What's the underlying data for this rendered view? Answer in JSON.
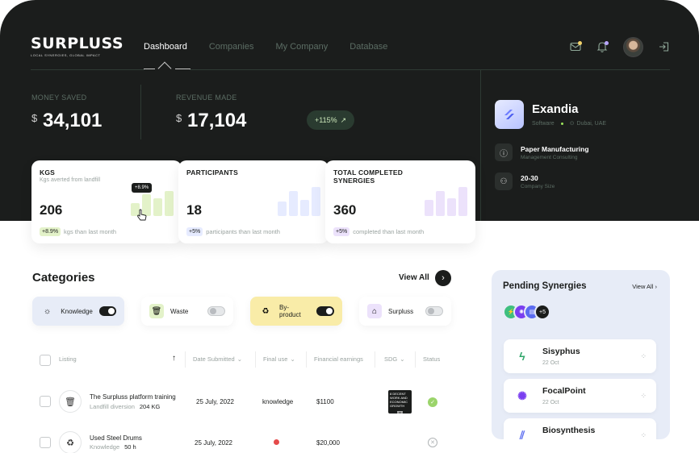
{
  "brand": {
    "logo_text": "SURPLUSS",
    "tagline": "LOCAL SYNERGIES, GLOBAL IMPACT"
  },
  "nav": {
    "tabs": [
      {
        "label": "Dashboard"
      },
      {
        "label": "Companies"
      },
      {
        "label": "My Company"
      },
      {
        "label": "Database"
      }
    ]
  },
  "header_icons": [
    "mail-icon",
    "bell-icon",
    "avatar",
    "logout-icon"
  ],
  "stats": {
    "money_saved": {
      "label": "MONEY SAVED",
      "currency": "$",
      "value": "34,101"
    },
    "revenue_made": {
      "label": "REVENUE MADE",
      "currency": "$",
      "value": "17,104",
      "growth": "+115%"
    }
  },
  "cards": [
    {
      "title": "KGS",
      "subtitle": "Kgs averted from landfill",
      "value": "206",
      "badge": "+8.9%",
      "footer": "kgs  than last month",
      "tooltip": "+8.9%",
      "accent": "#e3f2c9",
      "bar_levels": [
        0.45,
        0.75,
        0.6,
        0.85
      ]
    },
    {
      "title": "PARTICIPANTS",
      "subtitle": "",
      "value": "18",
      "badge": "+5%",
      "footer": "participants than last month",
      "accent": "#e6ebff",
      "bar_levels": [
        0.5,
        0.85,
        0.55,
        1.0
      ]
    },
    {
      "title": "TOTAL COMPLETED SYNERGIES",
      "subtitle": "",
      "value": "360",
      "badge": "+5%",
      "footer": "completed than last month",
      "accent": "#ece2fb",
      "bar_levels": [
        0.55,
        0.85,
        0.6,
        1.0
      ]
    }
  ],
  "company": {
    "name": "Exandia",
    "type": "Software",
    "location": "Dubai, UAE",
    "industry": "Paper Manufacturing",
    "industry_sub": "Management Consulting",
    "size": "20-30",
    "size_label": "Company Size"
  },
  "categories": {
    "title": "Categories",
    "view_all": "View All",
    "items": [
      {
        "label": "Knowledge",
        "on": true,
        "bg": "#e7ecf7"
      },
      {
        "label": "Waste",
        "on": false,
        "bg": "#ffffff"
      },
      {
        "label": "By-product",
        "on": true,
        "bg": "#f9eca8"
      },
      {
        "label": "Surpluss",
        "on": false,
        "bg": "#ffffff"
      }
    ]
  },
  "table": {
    "headers": [
      "Listing",
      "Date Submitted",
      "Final use",
      "Financial earnings",
      "SDG",
      "Status"
    ],
    "rows": [
      {
        "title": "The Surpluss platform training",
        "sub": "Landfill diversion",
        "qty": "204 KG",
        "date": "25 July, 2022",
        "final_use": "knowledge",
        "earnings": "$1100",
        "sdg": "8 DECENT WORK AND ECONOMIC GROWTH",
        "status": "completed"
      },
      {
        "title": "Used Steel Drums",
        "sub": "Knowledge",
        "qty": "50 h",
        "date": "25 July, 2022",
        "final_use": "",
        "earnings": "$20,000",
        "sdg": "",
        "status": "cancelled"
      }
    ]
  },
  "pending": {
    "title": "Pending Synergies",
    "view_all": "View All",
    "more_count": "+5",
    "items": [
      {
        "name": "Sisyphus",
        "date": "22 Oct"
      },
      {
        "name": "FocalPoint",
        "date": "22 Oct"
      },
      {
        "name": "Biosynthesis",
        "date": ""
      }
    ]
  }
}
